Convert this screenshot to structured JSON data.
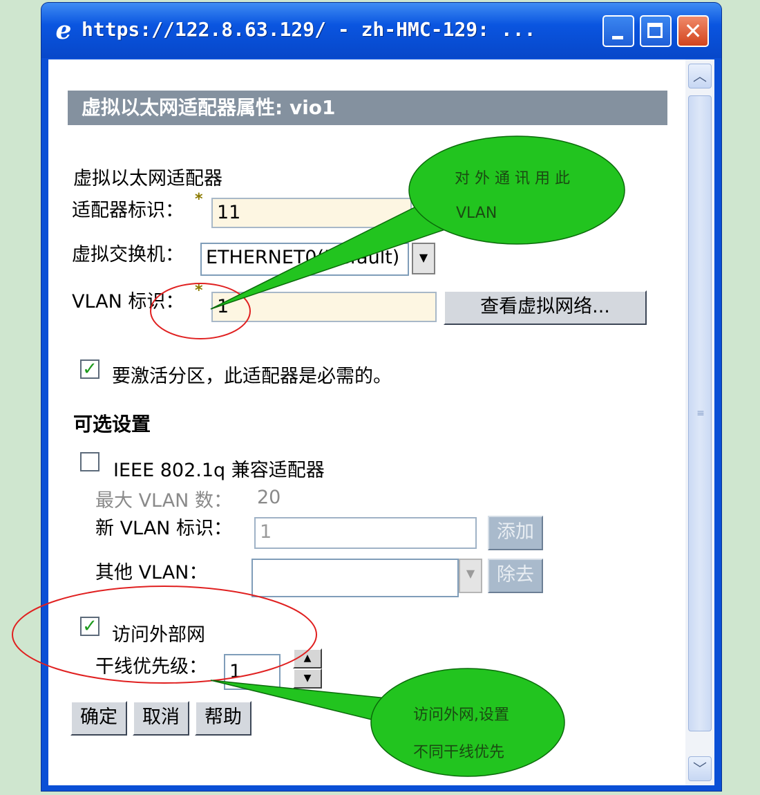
{
  "window": {
    "title": "https://122.8.63.129/ - zh-HMC-129: ...",
    "close_glyph": "✕"
  },
  "page": {
    "header": "虚拟以太网适配器属性: vio1",
    "section_title": "虚拟以太网适配器",
    "adapter_id": {
      "label": "适配器标识：",
      "value": "11"
    },
    "virtual_switch": {
      "label": "虚拟交换机：",
      "value": "ETHERNET0(Default)"
    },
    "vlan_id": {
      "label": "VLAN 标识：",
      "value": "1"
    },
    "view_network_button": "查看虚拟网络...",
    "required_checkbox": {
      "label": "要激活分区，此适配器是必需的。",
      "checked": true
    },
    "optional_title": "可选设置",
    "ieee_checkbox": {
      "label": "IEEE 802.1q 兼容适配器",
      "checked": false
    },
    "max_vlan": {
      "label": "最大 VLAN 数：",
      "value": "20"
    },
    "new_vlan": {
      "label": "新 VLAN 标识：",
      "value": "1"
    },
    "add_button": "添加",
    "other_vlan": {
      "label": "其他 VLAN：",
      "value": ""
    },
    "remove_button": "除去",
    "external_checkbox": {
      "label": "访问外部网",
      "checked": true
    },
    "trunk_priority": {
      "label": "干线优先级：",
      "value": "1"
    },
    "ok_button": "确定",
    "cancel_button": "取消",
    "help_button": "帮助"
  },
  "annotations": {
    "callout_vlan": [
      "对 外 通 讯 用 此",
      "VLAN"
    ],
    "callout_trunk": [
      "访问外网,设置",
      "不同干线优先"
    ]
  },
  "colors": {
    "callout_fill": "#22c41f",
    "circle": "#e02020",
    "header_bg": "#84919f"
  }
}
